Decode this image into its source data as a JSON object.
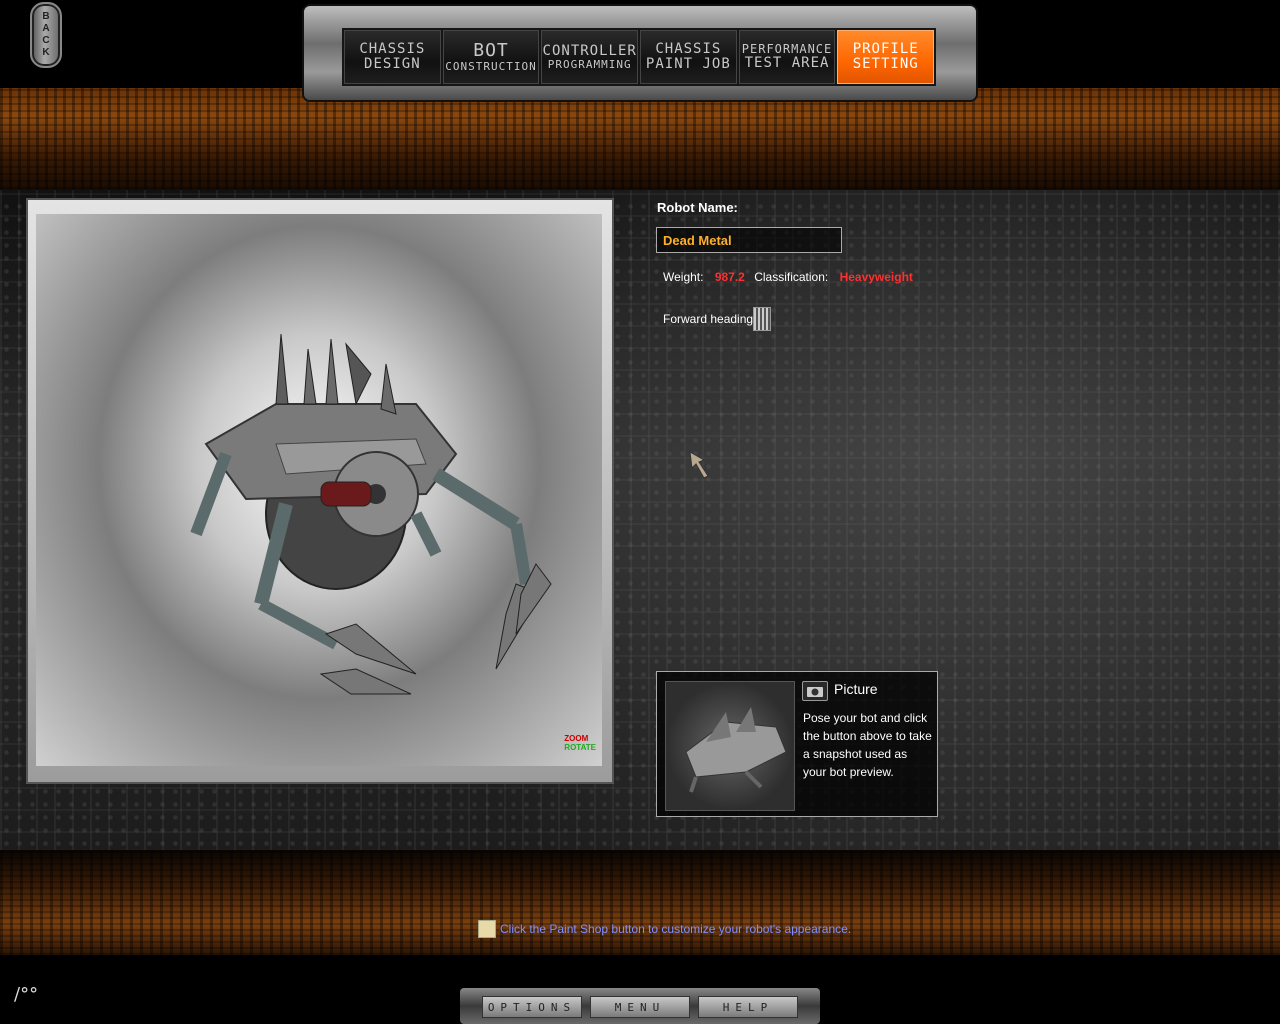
{
  "back_button": {
    "label": "BACK"
  },
  "tabs": [
    {
      "line1": "CHASSIS",
      "line2": "DESIGN",
      "active": false
    },
    {
      "line1": "BOT",
      "line2": "CONSTRUCTION",
      "active": false
    },
    {
      "line1": "CONTROLLER",
      "line2": "PROGRAMMING",
      "active": false
    },
    {
      "line1": "CHASSIS",
      "line2": "PAINT JOB",
      "active": false
    },
    {
      "line1": "PERFORMANCE",
      "line2": "TEST AREA",
      "active": false
    },
    {
      "line1": "PROFILE",
      "line2": "SETTING",
      "active": true
    }
  ],
  "viewport": {
    "zoom_label": "ZOOM",
    "rotate_label": "ROTATE"
  },
  "profile": {
    "robot_name_label": "Robot Name:",
    "robot_name_value": "Dead Metal",
    "weight_label": "Weight:",
    "weight_value": "987.2",
    "classification_label": "Classification:",
    "classification_value": "Heavyweight",
    "forward_heading_label": "Forward heading:"
  },
  "picture": {
    "title": "Picture",
    "description": "Pose your bot and click the button above to take a snapshot used as your bot preview."
  },
  "hint": "Click the Paint Shop button to customize your robot's appearance.",
  "bottom_bar": {
    "options": "OPTIONS",
    "menu": "MENU",
    "help": "HELP"
  },
  "colors": {
    "accent": "#ff6600",
    "name": "#ffb02a",
    "alert": "#ff3030",
    "hint": "#7f8fff"
  }
}
